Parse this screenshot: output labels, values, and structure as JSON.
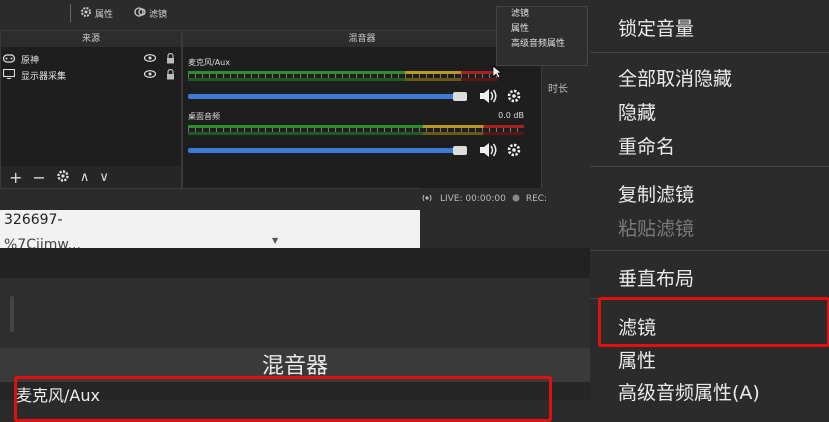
{
  "toolbar": {
    "properties_label": "属性",
    "filters_label": "滤镜"
  },
  "sources": {
    "title": "来源",
    "items": [
      {
        "label": "原神"
      },
      {
        "label": "显示器采集"
      }
    ],
    "tools": {
      "add": "+",
      "remove": "−",
      "up": "∧",
      "down": "∨"
    }
  },
  "mixer": {
    "title": "混音器",
    "tracks": [
      {
        "name": "麦克风/Aux",
        "level": ""
      },
      {
        "name": "桌面音频",
        "level": "0.0 dB"
      }
    ]
  },
  "small_menu": {
    "items": [
      "滤镜",
      "属性",
      "高级音频属性"
    ]
  },
  "side_tab_label": "时长",
  "status": {
    "live": "LIVE: 00:00:00",
    "rec": "REC:"
  },
  "text_area": {
    "line1": "326697-",
    "line2": "%7Cijmw..."
  },
  "bottom_mixer": {
    "title": "混音器",
    "row_label": "麦克风/Aux"
  },
  "context_menu": {
    "items": [
      {
        "label": "锁定音量",
        "disabled": false
      },
      {
        "label": "全部取消隐藏",
        "disabled": false
      },
      {
        "label": "隐藏",
        "disabled": false
      },
      {
        "label": "重命名",
        "disabled": false
      },
      {
        "label": "复制滤镜",
        "disabled": false
      },
      {
        "label": "粘贴滤镜",
        "disabled": true
      },
      {
        "label": "垂直布局",
        "disabled": false
      },
      {
        "label": "滤镜",
        "disabled": false
      },
      {
        "label": "属性",
        "disabled": false
      },
      {
        "label": "高级音频属性(A)",
        "disabled": false
      }
    ]
  },
  "colors": {
    "highlight": "#e01010",
    "slider": "#3d7bd6"
  }
}
